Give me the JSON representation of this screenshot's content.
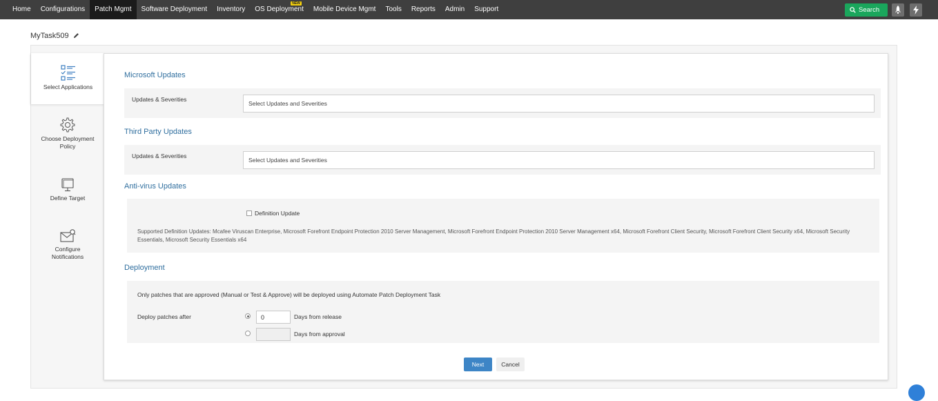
{
  "nav": {
    "items": [
      {
        "label": "Home"
      },
      {
        "label": "Configurations"
      },
      {
        "label": "Patch Mgmt"
      },
      {
        "label": "Software Deployment"
      },
      {
        "label": "Inventory"
      },
      {
        "label": "OS Deployment"
      },
      {
        "label": "Mobile Device Mgmt"
      },
      {
        "label": "Tools"
      },
      {
        "label": "Reports"
      },
      {
        "label": "Admin"
      },
      {
        "label": "Support"
      }
    ],
    "active_item": "Patch Mgmt",
    "new_badge": "NEW",
    "search_label": "Search",
    "search_color": "#1aa65c"
  },
  "task": {
    "name": "MyTask509"
  },
  "steps": [
    {
      "label": "Select Applications",
      "icon": "checklist-icon"
    },
    {
      "label": "Choose Deployment Policy",
      "icon": "gear-icon"
    },
    {
      "label": "Define Target",
      "icon": "monitor-icon"
    },
    {
      "label": "Configure Notifications",
      "icon": "envelope-icon"
    }
  ],
  "microsoft": {
    "title": "Microsoft Updates",
    "row_label": "Updates & Severities",
    "placeholder": "Select Updates and Severities"
  },
  "third_party": {
    "title": "Third Party Updates",
    "row_label": "Updates & Severities",
    "placeholder": "Select Updates and Severities"
  },
  "antivirus": {
    "title": "Anti-virus Updates",
    "checkbox_label": "Definition Update",
    "supported_text": "Supported Definition Updates:   Mcafee Viruscan Enterprise, Microsoft Forefront Endpoint Protection 2010 Server Management, Microsoft Forefront Endpoint Protection 2010 Server Management x64, Microsoft Forefront Client Security, Microsoft Forefront Client Security x64, Microsoft Security Essentials, Microsoft Security Essentials x64"
  },
  "deployment": {
    "title": "Deployment",
    "note": "Only patches that are approved (Manual or Test & Approve) will be deployed using Automate Patch Deployment Task",
    "deploy_label": "Deploy patches after",
    "days_value": "0",
    "release_label": "Days from release",
    "approval_label": "Days from approval"
  },
  "actions": {
    "next": "Next",
    "cancel": "Cancel",
    "primary_color": "#3d85c6"
  }
}
